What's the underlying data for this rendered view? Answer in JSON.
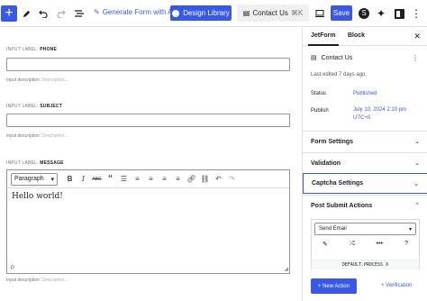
{
  "toolbar": {
    "add_icon": "plus-icon",
    "generate_label": "Generate Form with AI",
    "design_label": "Design Library",
    "doc_title": "Contact Us",
    "shortcut": "⌘K",
    "save_label": "Save"
  },
  "fields": [
    {
      "label_prefix": "INPUT LABEL:",
      "label": "PHONE",
      "desc_prefix": "Input description:",
      "desc_placeholder": "Description..."
    },
    {
      "label_prefix": "INPUT LABEL:",
      "label": "SUBJECT",
      "desc_prefix": "Input description:",
      "desc_placeholder": "Description..."
    },
    {
      "label_prefix": "INPUT LABEL:",
      "label": "MESSAGE",
      "desc_prefix": "Input description:",
      "desc_placeholder": "Description..."
    }
  ],
  "editor": {
    "format": "Paragraph",
    "content": "Hello world!",
    "path": "P"
  },
  "sidebar": {
    "tabs": [
      "JetForm",
      "Block"
    ],
    "doc_title": "Contact Us",
    "last_edited": "Last edited 7 days ago.",
    "status_label": "Status",
    "status_value": "Published",
    "publish_label": "Publish",
    "publish_value_1": "July 10, 2024 2:10 pm",
    "publish_value_2": "UTC+0",
    "panels": [
      "Form Settings",
      "Validation",
      "Captcha Settings",
      "Post Submit Actions"
    ],
    "action_select": "Send Email",
    "action_code": "DEFAULT.PROCESS",
    "action_code_x": "X",
    "new_action": "+ New Action",
    "verification": "+ Verification"
  }
}
